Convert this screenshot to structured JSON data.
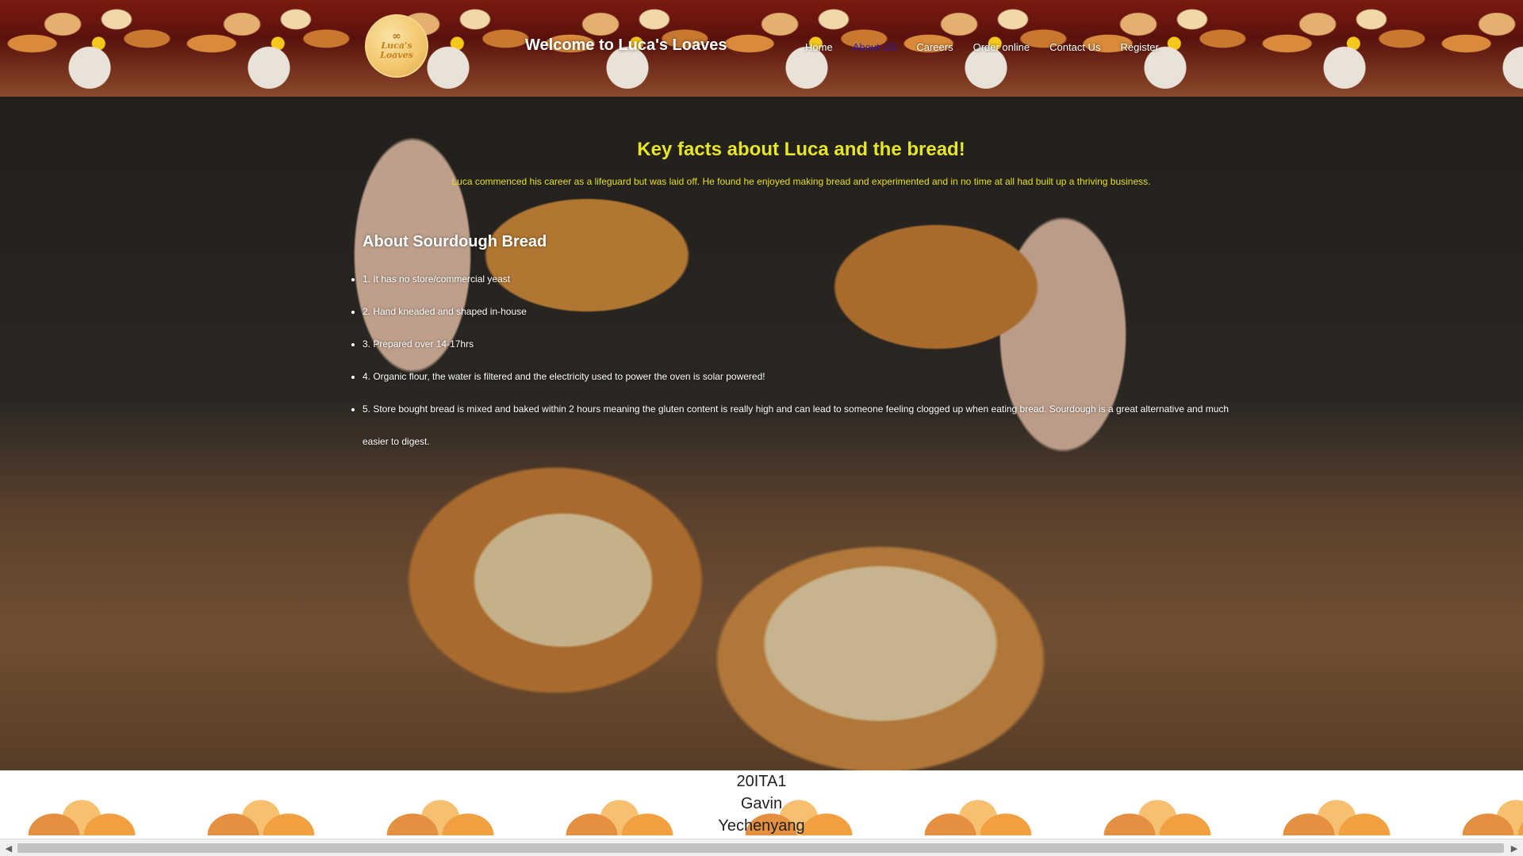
{
  "header": {
    "logo_text_line1": "Luca's",
    "logo_text_line2": "Loaves",
    "site_title": "Welcome to Luca's Loaves"
  },
  "nav": {
    "items": [
      {
        "label": "Home",
        "active": false
      },
      {
        "label": "About US",
        "active": true
      },
      {
        "label": "Careers",
        "active": false
      },
      {
        "label": "Order online",
        "active": false
      },
      {
        "label": "Contact Us",
        "active": false
      },
      {
        "label": "Register",
        "active": false
      }
    ]
  },
  "main": {
    "facts_title": "Key facts about Luca and the bread!",
    "facts_text": "Luca commenced his career as a lifeguard but was laid off. He found he enjoyed making bread and experimented and in no time at all had built up a thriving business.",
    "sourdough_title": "About Sourdough Bread",
    "sourdough_facts": [
      "1. It has no store/commercial yeast",
      "2. Hand kneaded and shaped in-house",
      "3. Prepared over 14-17hrs",
      "4. Organic flour, the water is filtered and the electricity used to power the oven is solar powered!",
      "5. Store bought bread is mixed and baked within 2 hours meaning the gluten content is really high and can lead to someone feeling clogged up when eating bread. Sourdough is a great alternative and much easier to digest."
    ]
  },
  "footer": {
    "line1": "20ITA1",
    "line2": "Gavin",
    "line3": "Yechenyang"
  },
  "colors": {
    "facts_title": "#e6e626",
    "active_nav": "#2a1aa8"
  }
}
